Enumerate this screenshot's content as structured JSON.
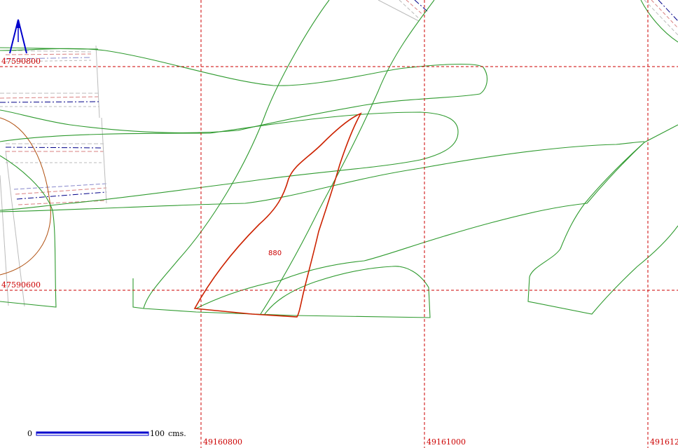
{
  "grid": {
    "y_labels": [
      "47590800",
      "47590600"
    ],
    "x_labels": [
      "49160800",
      "49161000",
      "4916120"
    ]
  },
  "parcel": {
    "id": "880"
  },
  "scale_bar": {
    "start_label": "0",
    "end_label": "100",
    "unit_label": "cms."
  },
  "north_arrow": {
    "icon": "north-arrow-icon"
  },
  "colors": {
    "grid": "#cc0000",
    "parcel_outline": "#cc2200",
    "contours": "#2e9a2e",
    "north_arrow": "#0000cc",
    "scale_bar": "#0000cc"
  }
}
